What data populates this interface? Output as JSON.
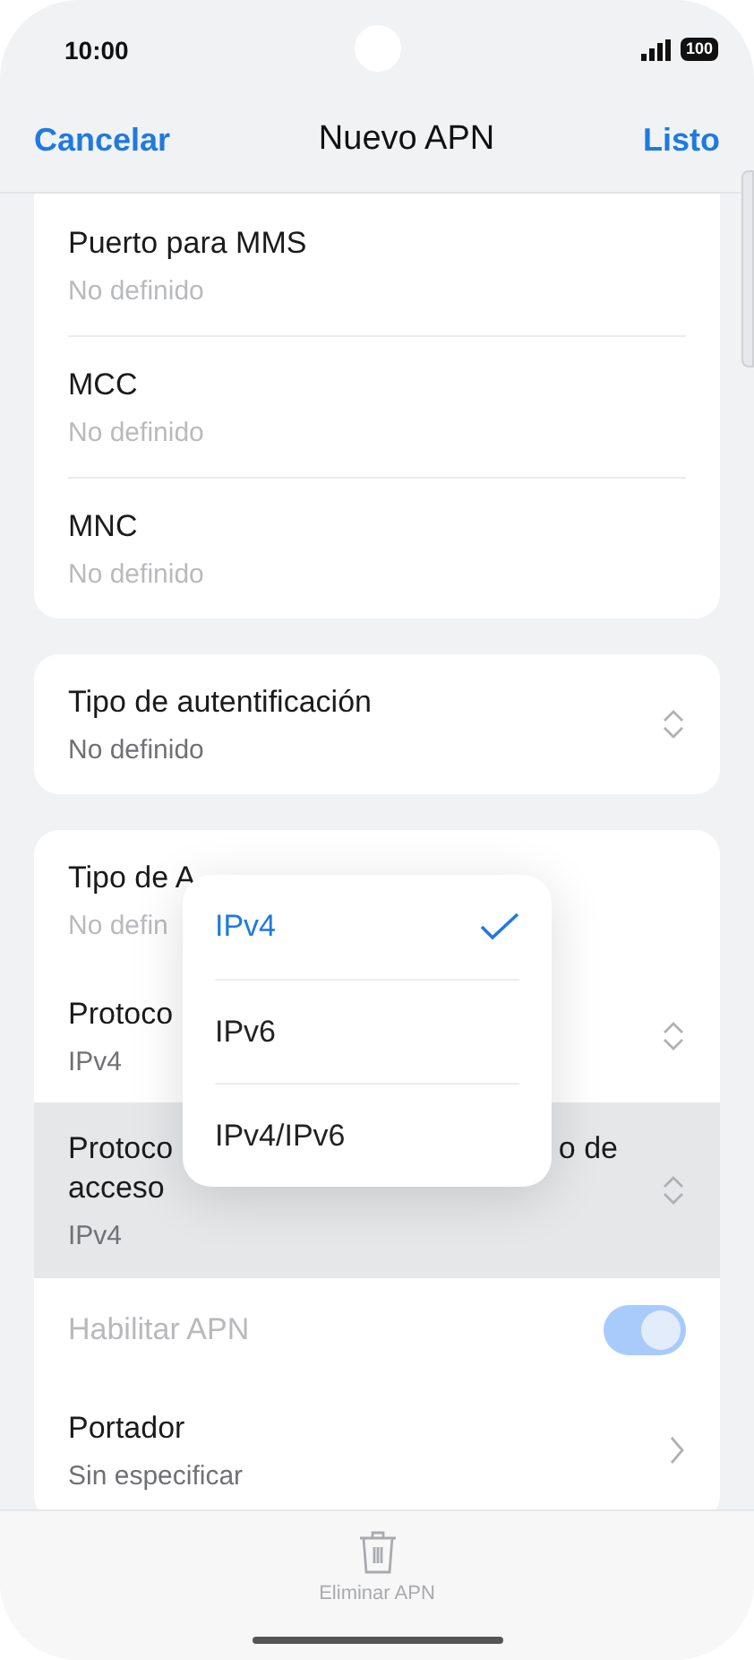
{
  "status_bar": {
    "time": "10:00",
    "battery": "100"
  },
  "nav": {
    "cancel": "Cancelar",
    "title": "Nuevo APN",
    "done": "Listo"
  },
  "cards": [
    {
      "clipped_top": true,
      "rows": [
        {
          "kind": "value",
          "label": "Puerto para MMS",
          "placeholder": "No definido"
        },
        {
          "kind": "value",
          "label": "MCC",
          "placeholder": "No definido"
        },
        {
          "kind": "value",
          "label": "MNC",
          "placeholder": "No definido"
        }
      ]
    },
    {
      "clipped_top": false,
      "rows": [
        {
          "kind": "select",
          "label": "Tipo de autentificación",
          "value": "No definido"
        }
      ]
    },
    {
      "clipped_top": false,
      "rows": [
        {
          "kind": "value",
          "label": "Tipo de A",
          "placeholder": "No defin"
        },
        {
          "kind": "select",
          "label": "Protoco",
          "value": "IPv4"
        },
        {
          "kind": "select",
          "label": "Protoco",
          "label_end": "o de",
          "label_line2": "acceso",
          "value": "IPv4",
          "pressed": true
        },
        {
          "kind": "toggle",
          "label": "Habilitar APN",
          "on": true,
          "disabled": true
        },
        {
          "kind": "chevron",
          "label": "Portador",
          "value": "Sin especificar"
        }
      ]
    }
  ],
  "popup": {
    "options": [
      {
        "label": "IPv4",
        "selected": true
      },
      {
        "label": "IPv6",
        "selected": false
      },
      {
        "label": "IPv4/IPv6",
        "selected": false
      }
    ]
  },
  "bottom_bar": {
    "delete": "Eliminar APN"
  }
}
